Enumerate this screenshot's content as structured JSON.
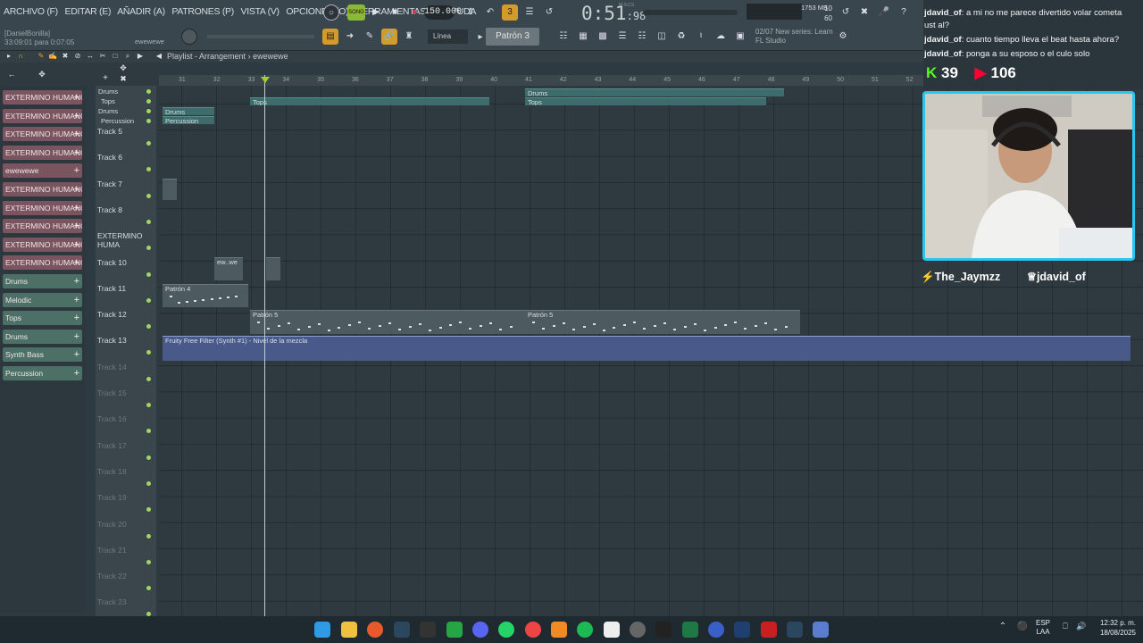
{
  "menu": [
    "ARCHIVO (F)",
    "EDITAR (E)",
    "AÑADIR (A)",
    "PATRONES (P)",
    "VISTA (V)",
    "OPCIONES (O)",
    "HERRAMIENTAS (T)",
    "AYUDA"
  ],
  "transport": {
    "song_label": "SONG",
    "tempo": "150.000",
    "time": "0:51",
    "time_frac": "98",
    "time_unit": "M:S:CS"
  },
  "hint": {
    "user": "[DanielBonilla]",
    "time": "33:09:01 para 0:07:05",
    "hint_right": "ewewewe"
  },
  "toolbar": {
    "snap": "Línea",
    "pattern": "Patrón 3",
    "news_date": "02/07",
    "news_text": "New series: Learn",
    "news_sub": "FL Studio",
    "cpu_val": "10",
    "cpu_sub": "60",
    "mem": "1753 MB"
  },
  "playlist": {
    "title": "Playlist - Arrangement",
    "arrow": "›",
    "clip_name": "ewewewe"
  },
  "ruler": [
    "31",
    "32",
    "33",
    "34",
    "35",
    "36",
    "37",
    "38",
    "39",
    "40",
    "41",
    "42",
    "43",
    "44",
    "45",
    "46",
    "47",
    "48",
    "49",
    "50",
    "51",
    "52",
    "53",
    "54",
    "55",
    "56",
    "57",
    "58"
  ],
  "browser": [
    {
      "label": "EXTERMINO HUMANO...",
      "color": "#7a5560"
    },
    {
      "label": "EXTERMINO HUMANO...",
      "color": "#7a5560"
    },
    {
      "label": "EXTERMINO HUMANO...",
      "color": "#7a5560"
    },
    {
      "label": "EXTERMINO HUMANO...",
      "color": "#7a5560"
    },
    {
      "label": "ewewewe",
      "color": "#7a5560"
    },
    {
      "label": "EXTERMINO HUMANO...",
      "color": "#7a5560"
    },
    {
      "label": "EXTERMINO HUMANO...",
      "color": "#7a5560"
    },
    {
      "label": "EXTERMINO HUMANO...",
      "color": "#7a5560"
    },
    {
      "label": "EXTERMINO HUMANO...",
      "color": "#7a5560"
    },
    {
      "label": "EXTERMINO HUMANO...",
      "color": "#7a5560"
    },
    {
      "label": "Drums",
      "color": "#4c6f66"
    },
    {
      "label": "Melodic",
      "color": "#4c6f66"
    },
    {
      "label": "Tops",
      "color": "#4c6f66"
    },
    {
      "label": "Drums",
      "color": "#4c6f66"
    },
    {
      "label": "Synth Bass",
      "color": "#4c6f66"
    },
    {
      "label": "Percussion",
      "color": "#4c6f66"
    }
  ],
  "tracks": [
    {
      "label": "Drums"
    },
    {
      "label": "Tops"
    },
    {
      "label": "Drums"
    },
    {
      "label": "Percussion"
    },
    {
      "label": "Track 5"
    },
    {
      "label": "Track 6"
    },
    {
      "label": "Track 7"
    },
    {
      "label": "Track 8"
    },
    {
      "label": "EXTERMINO HUMA"
    },
    {
      "label": "Track 10"
    },
    {
      "label": "Track 11"
    },
    {
      "label": "Track 12"
    },
    {
      "label": "Track 13"
    },
    {
      "label": "Track 14"
    },
    {
      "label": "Track 15"
    },
    {
      "label": "Track 16"
    },
    {
      "label": "Track 17"
    },
    {
      "label": "Track 18"
    },
    {
      "label": "Track 19"
    },
    {
      "label": "Track 20"
    },
    {
      "label": "Track 21"
    },
    {
      "label": "Track 22"
    },
    {
      "label": "Track 23"
    }
  ],
  "clips": {
    "drums_top": "Drums",
    "tops_a": "Tops",
    "drums_b": "Drums",
    "tops_b": "Tops",
    "drums_small": "Drums",
    "perc_small": "Percussion",
    "ewewe": "ew..we",
    "patron4": "Patrón 4",
    "patron5a": "Patrón 5",
    "patron5b": "Patrón 5",
    "automation": "Fruity Free Filter (Synth #1) - Nivel de la mezcla"
  },
  "chat": [
    {
      "user": "jdavid_of",
      "text": ": a mi no me parece divertido volar cometa"
    },
    {
      "user": "",
      "text": "ust al?"
    },
    {
      "user": "jdavid_of",
      "text": ": cuanto tiempo lleva el beat hasta ahora?"
    },
    {
      "user": "jdavid_of",
      "text": ": ponga a su esposo o el culo solo"
    }
  ],
  "viewers": {
    "kick": "39",
    "youtube": "106"
  },
  "overlay_names": {
    "left": "The_Jaymzz",
    "right": "jdavid_of"
  },
  "tray": {
    "lang": "ESP",
    "lang2": "LAA",
    "time": "12:32 p. m.",
    "date": "18/08/2025"
  }
}
